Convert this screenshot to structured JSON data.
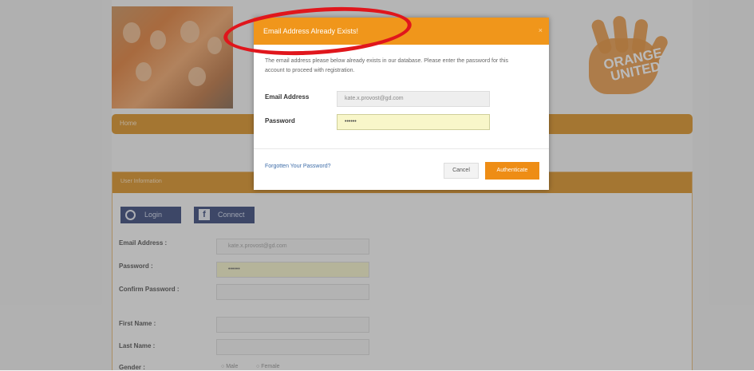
{
  "header": {
    "logo_text": "ORANGE UNITED",
    "nav_items": [
      "Home"
    ]
  },
  "panel": {
    "title": "User Information",
    "login_label": "Login",
    "connect_label": "Connect",
    "fields": [
      {
        "label": "Email Address :",
        "value": "kate.x.provost@gd.com"
      },
      {
        "label": "Password :",
        "value": "••••••"
      },
      {
        "label": "Confirm Password :",
        "value": ""
      },
      {
        "label": "First Name :",
        "value": ""
      },
      {
        "label": "Last Name :",
        "value": ""
      },
      {
        "label": "Gender :",
        "value": ""
      }
    ],
    "gender_options": [
      "Male",
      "Female"
    ]
  },
  "modal": {
    "title": "Email Address Already Exists!",
    "close": "×",
    "message": "The email address please below already exists in our database. Please enter the password for this account to proceed with registration.",
    "email_label": "Email Address",
    "email_value": "kate.x.provost@gd.com",
    "password_label": "Password",
    "password_value": "••••••",
    "forgot_link": "Forgotten Your Password?",
    "cancel_label": "Cancel",
    "auth_label": "Authenticate"
  }
}
